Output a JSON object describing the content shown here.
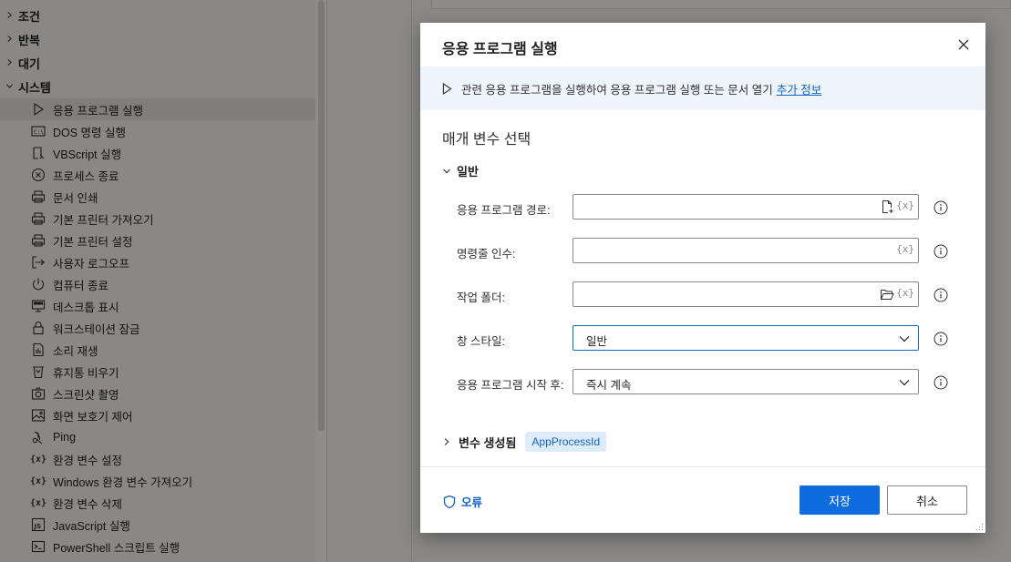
{
  "sidebar": {
    "categories": [
      {
        "label": "조건",
        "expanded": false
      },
      {
        "label": "반복",
        "expanded": false
      },
      {
        "label": "대기",
        "expanded": false
      },
      {
        "label": "시스템",
        "expanded": true
      }
    ],
    "items": [
      {
        "label": "응용 프로그램 실행",
        "icon": "play-icon"
      },
      {
        "label": "DOS 명령 실행",
        "icon": "cmd-icon"
      },
      {
        "label": "VBScript 실행",
        "icon": "script-icon"
      },
      {
        "label": "프로세스 종료",
        "icon": "close-circle-icon"
      },
      {
        "label": "문서 인쇄",
        "icon": "printer-icon"
      },
      {
        "label": "기본 프린터 가져오기",
        "icon": "printer-icon"
      },
      {
        "label": "기본 프린터 설정",
        "icon": "printer-icon"
      },
      {
        "label": "사용자 로그오프",
        "icon": "logoff-icon"
      },
      {
        "label": "컴퓨터 종료",
        "icon": "power-icon"
      },
      {
        "label": "데스크톱 표시",
        "icon": "desktop-icon"
      },
      {
        "label": "워크스테이션 잠금",
        "icon": "lock-icon"
      },
      {
        "label": "소리 재생",
        "icon": "sound-file-icon"
      },
      {
        "label": "휴지통 비우기",
        "icon": "recycle-bin-icon"
      },
      {
        "label": "스크린샷 촬영",
        "icon": "camera-icon"
      },
      {
        "label": "화면 보호기 제어",
        "icon": "screensaver-icon"
      },
      {
        "label": "Ping",
        "icon": "ping-icon"
      },
      {
        "label": "환경 변수 설정",
        "icon": "variable-icon"
      },
      {
        "label": "Windows 환경 변수 가져오기",
        "icon": "variable-icon"
      },
      {
        "label": "환경 변수 삭제",
        "icon": "variable-icon"
      },
      {
        "label": "JavaScript 실행",
        "icon": "js-icon"
      },
      {
        "label": "PowerShell 스크립트 실행",
        "icon": "powershell-icon"
      }
    ],
    "selected_index": 0
  },
  "dialog": {
    "title": "응용 프로그램 실행",
    "info_text": "관련 응용 프로그램을 실행하여 응용 프로그램 실행 또는 문서 열기",
    "info_link": "추가 정보",
    "section_title": "매개 변수 선택",
    "group_label": "일반",
    "fields": [
      {
        "label": "응용 프로그램 경로:",
        "value": "",
        "type": "file"
      },
      {
        "label": "명령줄 인수:",
        "value": "",
        "type": "text"
      },
      {
        "label": "작업 폴더:",
        "value": "",
        "type": "folder"
      },
      {
        "label": "창 스타일:",
        "value": "일반",
        "type": "select"
      },
      {
        "label": "응용 프로그램 시작 후:",
        "value": "즉시 계속",
        "type": "select"
      }
    ],
    "variables_label": "변수 생성됨",
    "variable_name": "AppProcessId",
    "error_label": "오류",
    "save_label": "저장",
    "cancel_label": "취소",
    "var_symbol": "{x}",
    "cmd_icon_text": "C:\\",
    "js_icon_text": "JS"
  },
  "colors": {
    "accent": "#0f6cde",
    "link": "#0f62c7",
    "info_bar": "#eff5fc",
    "pill_bg": "#deecf9"
  }
}
